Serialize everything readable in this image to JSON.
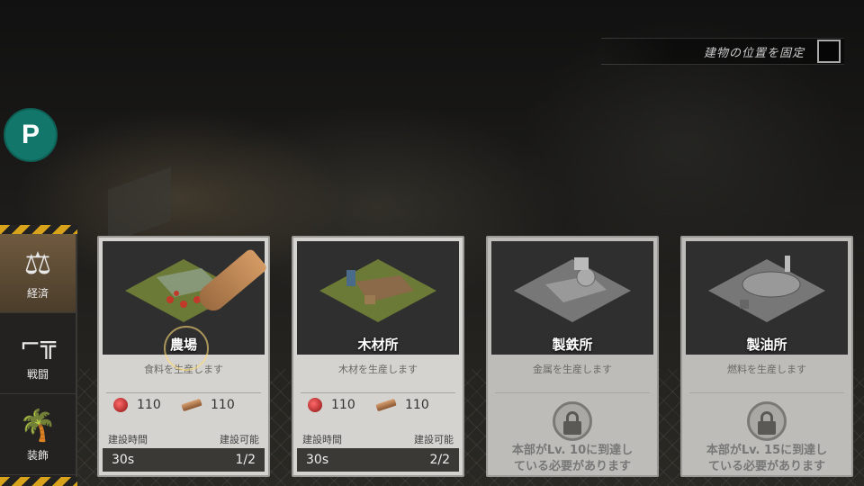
{
  "top_toggle": {
    "label": "建物の位置を固定",
    "checked": false
  },
  "p_button": {
    "label": "P",
    "color": "#12776a"
  },
  "sidebar": {
    "items": [
      {
        "label": "経済",
        "icon": "scales-icon",
        "active": true
      },
      {
        "label": "戦闘",
        "icon": "rifle-icon",
        "active": false
      },
      {
        "label": "装飾",
        "icon": "palm-tree-icon",
        "active": false
      }
    ]
  },
  "cards": [
    {
      "name": "農場",
      "desc": "食料を生産します",
      "food": "110",
      "wood": "110",
      "build_time_label": "建設時間",
      "build_avail_label": "建設可能",
      "build_time": "30s",
      "build_count": "1/2",
      "locked": false
    },
    {
      "name": "木材所",
      "desc": "木材を生産します",
      "food": "110",
      "wood": "110",
      "build_time_label": "建設時間",
      "build_avail_label": "建設可能",
      "build_time": "30s",
      "build_count": "2/2",
      "locked": false
    },
    {
      "name": "製鉄所",
      "desc": "金属を生産します",
      "locked": true,
      "lock_msg_1": "本部がLv. 10に到達し",
      "lock_msg_2": "ている必要があります"
    },
    {
      "name": "製油所",
      "desc": "燃料を生産します",
      "locked": true,
      "lock_msg_1": "本部がLv. 15に到達し",
      "lock_msg_2": "ている必要があります"
    }
  ],
  "colors": {
    "hazard": "#d8a21a",
    "active_tab": "#6f5a3e",
    "card_bg": "#d4d3cf"
  }
}
